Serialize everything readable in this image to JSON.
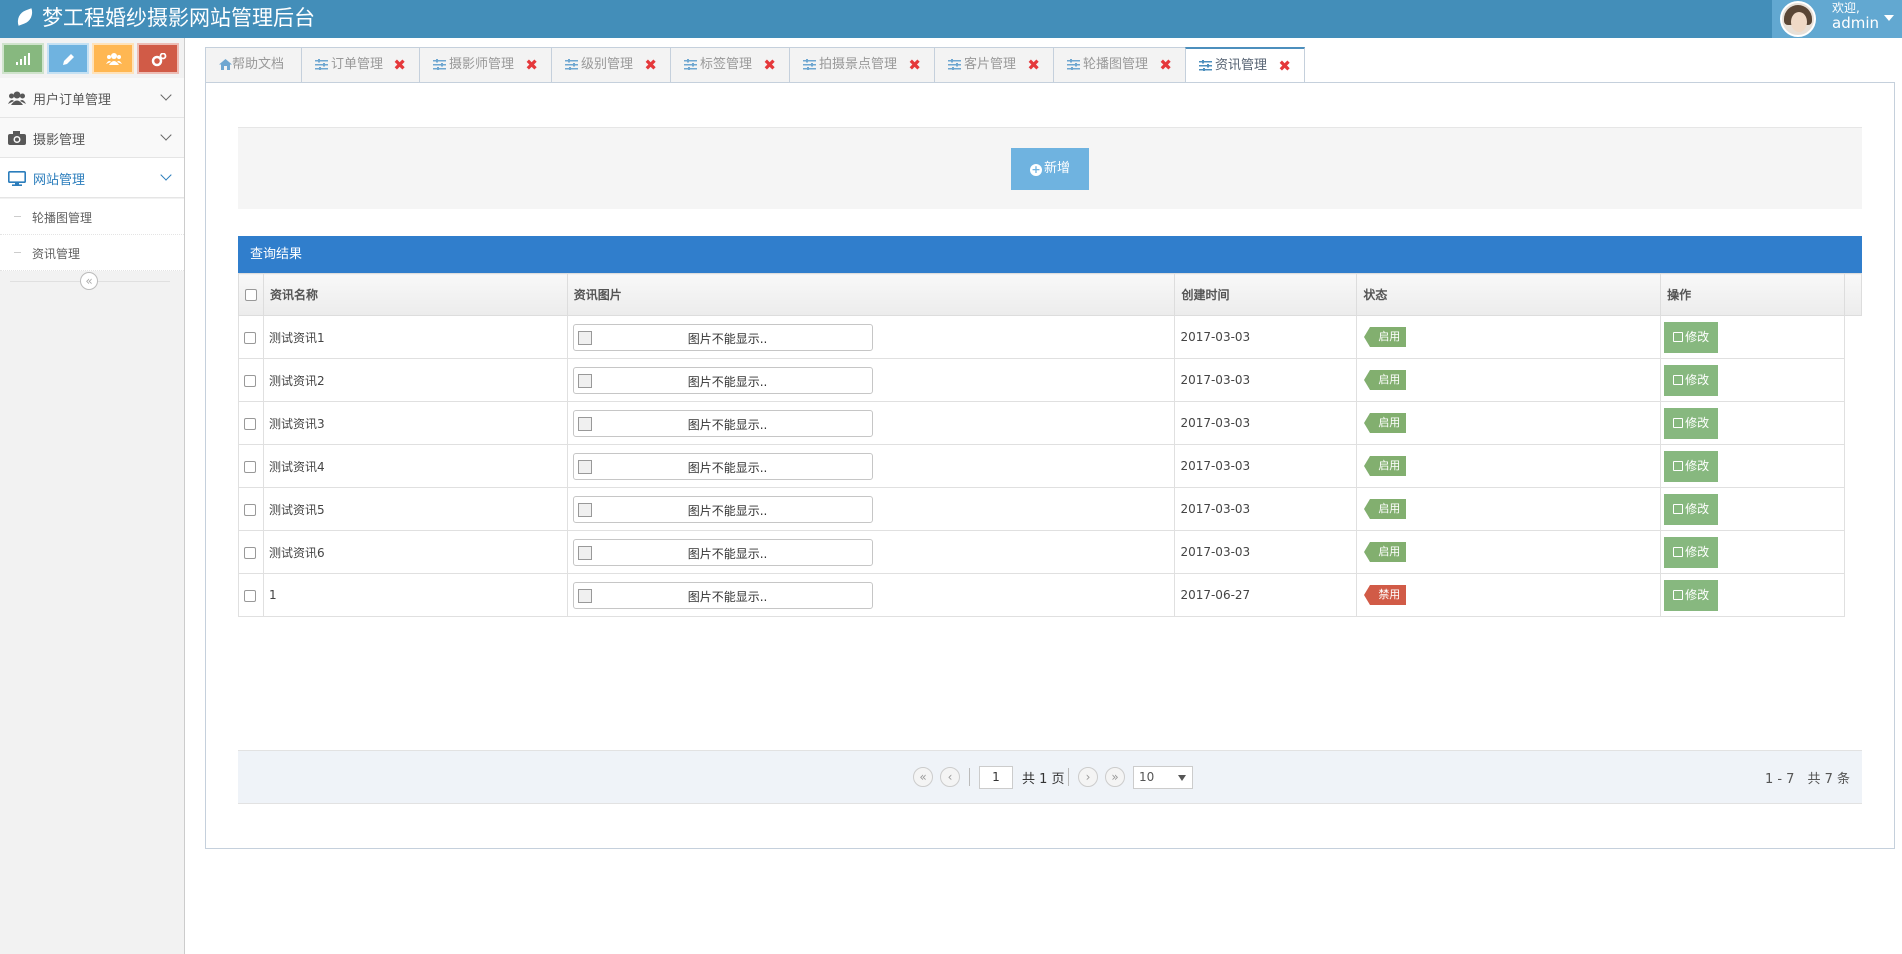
{
  "header": {
    "title": "梦工程婚纱摄影网站管理后台",
    "welcome": "欢迎,",
    "username": "admin"
  },
  "sidebar": {
    "shortcuts": [
      {
        "icon": "signal-icon",
        "color": "#87b87f"
      },
      {
        "icon": "pencil-icon",
        "color": "#6fb3e0"
      },
      {
        "icon": "group-icon",
        "color": "#ffb752"
      },
      {
        "icon": "cogs-icon",
        "color": "#d15b47"
      }
    ],
    "menu": [
      {
        "label": "用户订单管理",
        "icon": "users-icon"
      },
      {
        "label": "摄影管理",
        "icon": "camera-icon"
      },
      {
        "label": "网站管理",
        "icon": "desktop-icon",
        "active": true
      }
    ],
    "submenu": [
      {
        "label": "轮播图管理"
      },
      {
        "label": "资讯管理"
      }
    ],
    "collapse_icon": "«"
  },
  "tabs": [
    {
      "label": "帮助文档",
      "icon": "home-icon",
      "closable": false
    },
    {
      "label": "订单管理",
      "icon": "sliders-icon",
      "closable": true
    },
    {
      "label": "摄影师管理",
      "icon": "sliders-icon",
      "closable": true
    },
    {
      "label": "级别管理",
      "icon": "sliders-icon",
      "closable": true
    },
    {
      "label": "标签管理",
      "icon": "sliders-icon",
      "closable": true
    },
    {
      "label": "拍摄景点管理",
      "icon": "sliders-icon",
      "closable": true
    },
    {
      "label": "客片管理",
      "icon": "sliders-icon",
      "closable": true
    },
    {
      "label": "轮播图管理",
      "icon": "sliders-icon",
      "closable": true
    },
    {
      "label": "资讯管理",
      "icon": "sliders-icon",
      "closable": true,
      "active": true
    }
  ],
  "toolbar": {
    "add_label": "新增"
  },
  "grid": {
    "title": "查询结果",
    "columns": [
      "资讯名称",
      "资讯图片",
      "创建时间",
      "状态",
      "操作"
    ],
    "rows": [
      {
        "name": "测试资讯1",
        "image": "图片不能显示..",
        "created": "2017-03-03",
        "status": "启用",
        "action": "修改"
      },
      {
        "name": "测试资讯2",
        "image": "图片不能显示..",
        "created": "2017-03-03",
        "status": "启用",
        "action": "修改"
      },
      {
        "name": "测试资讯3",
        "image": "图片不能显示..",
        "created": "2017-03-03",
        "status": "启用",
        "action": "修改"
      },
      {
        "name": "测试资讯4",
        "image": "图片不能显示..",
        "created": "2017-03-03",
        "status": "启用",
        "action": "修改"
      },
      {
        "name": "测试资讯5",
        "image": "图片不能显示..",
        "created": "2017-03-03",
        "status": "启用",
        "action": "修改"
      },
      {
        "name": "测试资讯6",
        "image": "图片不能显示..",
        "created": "2017-03-03",
        "status": "启用",
        "action": "修改"
      },
      {
        "name": "1",
        "image": "图片不能显示..",
        "created": "2017-06-27",
        "status": "禁用",
        "action": "修改"
      }
    ]
  },
  "pager": {
    "page": "1",
    "total_pages": "共 1 页",
    "page_size": "10",
    "info": "1 - 7　共 7 条"
  },
  "colors": {
    "header": "#438eb9",
    "grid_title": "#307ecc",
    "status_on": "#82af6f",
    "status_off": "#d15b47",
    "edit_button": "#87b87f",
    "add_button": "#6fb3e0"
  }
}
